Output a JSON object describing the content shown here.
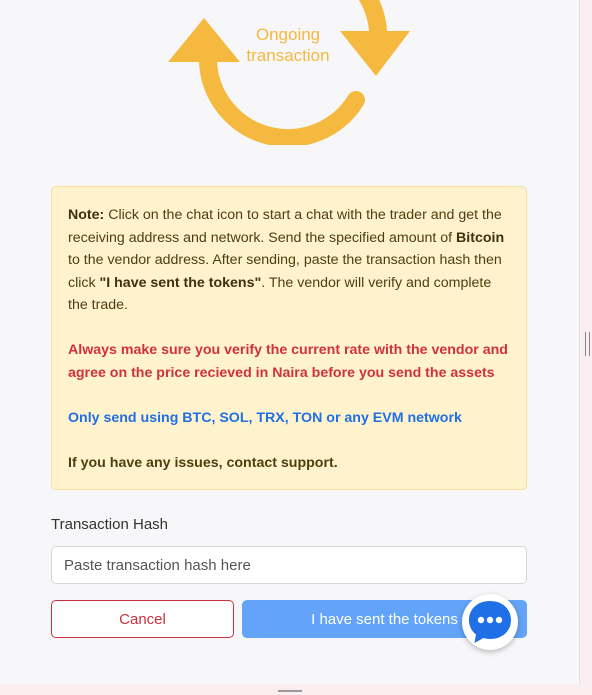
{
  "status": {
    "text_line1": "Ongoing",
    "text_line2": "transaction",
    "icon": "refresh-cycle-icon",
    "color": "#f5b93f"
  },
  "note": {
    "label": "Note:",
    "text1": " Click on the chat icon to start a chat with the trader and get the receiving address and network. Send the specified amount of ",
    "asset": "Bitcoin",
    "text2": " to the vendor address. After sending, paste the transaction hash then click ",
    "button_ref": "\"I have sent the tokens\"",
    "text3": ". The vendor will verify and complete the trade.",
    "warning": "Always make sure you verify the current rate with the vendor and agree on the price recieved in Naira before you send the assets",
    "networks": "Only send using BTC, SOL, TRX, TON or any EVM network",
    "support": "If you have any issues, contact support."
  },
  "form": {
    "hash_label": "Transaction Hash",
    "hash_placeholder": "Paste transaction hash here",
    "hash_value": ""
  },
  "buttons": {
    "cancel": "Cancel",
    "sent": "I have sent the tokens"
  },
  "chat": {
    "icon": "chat-bubble-icon"
  },
  "colors": {
    "accent": "#63a4f8",
    "danger": "#c8323f",
    "note_bg": "#fff3cd",
    "status": "#f5b93f"
  }
}
